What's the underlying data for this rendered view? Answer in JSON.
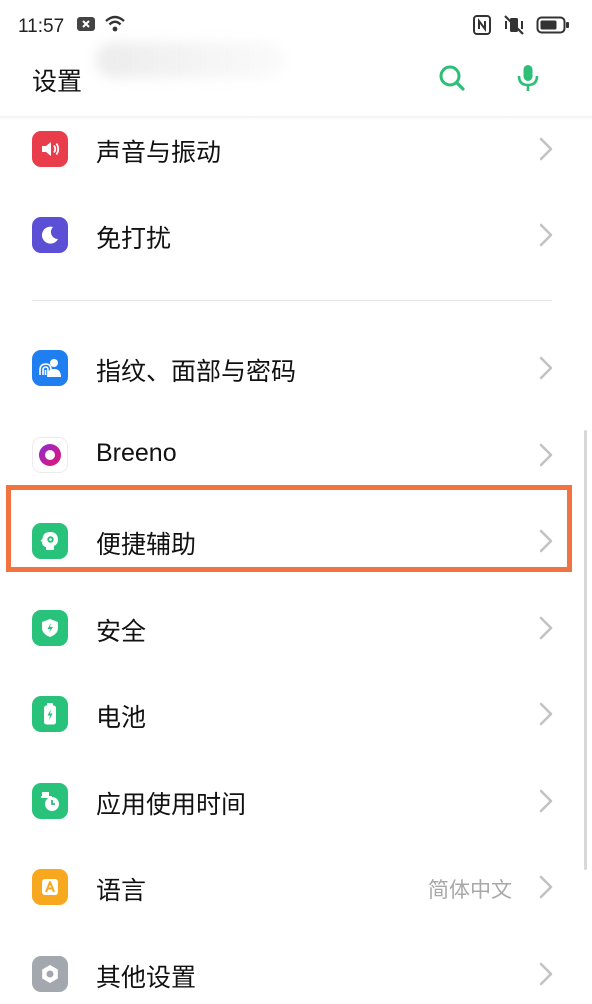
{
  "status_bar": {
    "time": "11:57"
  },
  "header": {
    "title": "设置"
  },
  "settings": {
    "items": [
      {
        "label": "声音与振动",
        "icon": "speaker-icon",
        "color": "#ea3d4b"
      },
      {
        "label": "免打扰",
        "icon": "moon-icon",
        "color": "#5b4fd6"
      },
      {
        "label": "指纹、面部与密码",
        "icon": "fingerprint-face-icon",
        "color": "#1f7ef0"
      },
      {
        "label": "Breeno",
        "icon": "breeno-icon",
        "color": "#c0188a"
      },
      {
        "label": "便捷辅助",
        "icon": "assist-icon",
        "color": "#29c27a"
      },
      {
        "label": "安全",
        "icon": "shield-icon",
        "color": "#29c27a"
      },
      {
        "label": "电池",
        "icon": "battery-icon",
        "color": "#29c27a"
      },
      {
        "label": "应用使用时间",
        "icon": "app-time-icon",
        "color": "#29c27a"
      },
      {
        "label": "语言",
        "icon": "language-icon",
        "color": "#f7a81f",
        "value": "简体中文"
      },
      {
        "label": "其他设置",
        "icon": "gear-icon",
        "color": "#a3a7ae"
      }
    ]
  },
  "colors": {
    "accent": "#2dbf78",
    "highlight": "#f2733f"
  }
}
